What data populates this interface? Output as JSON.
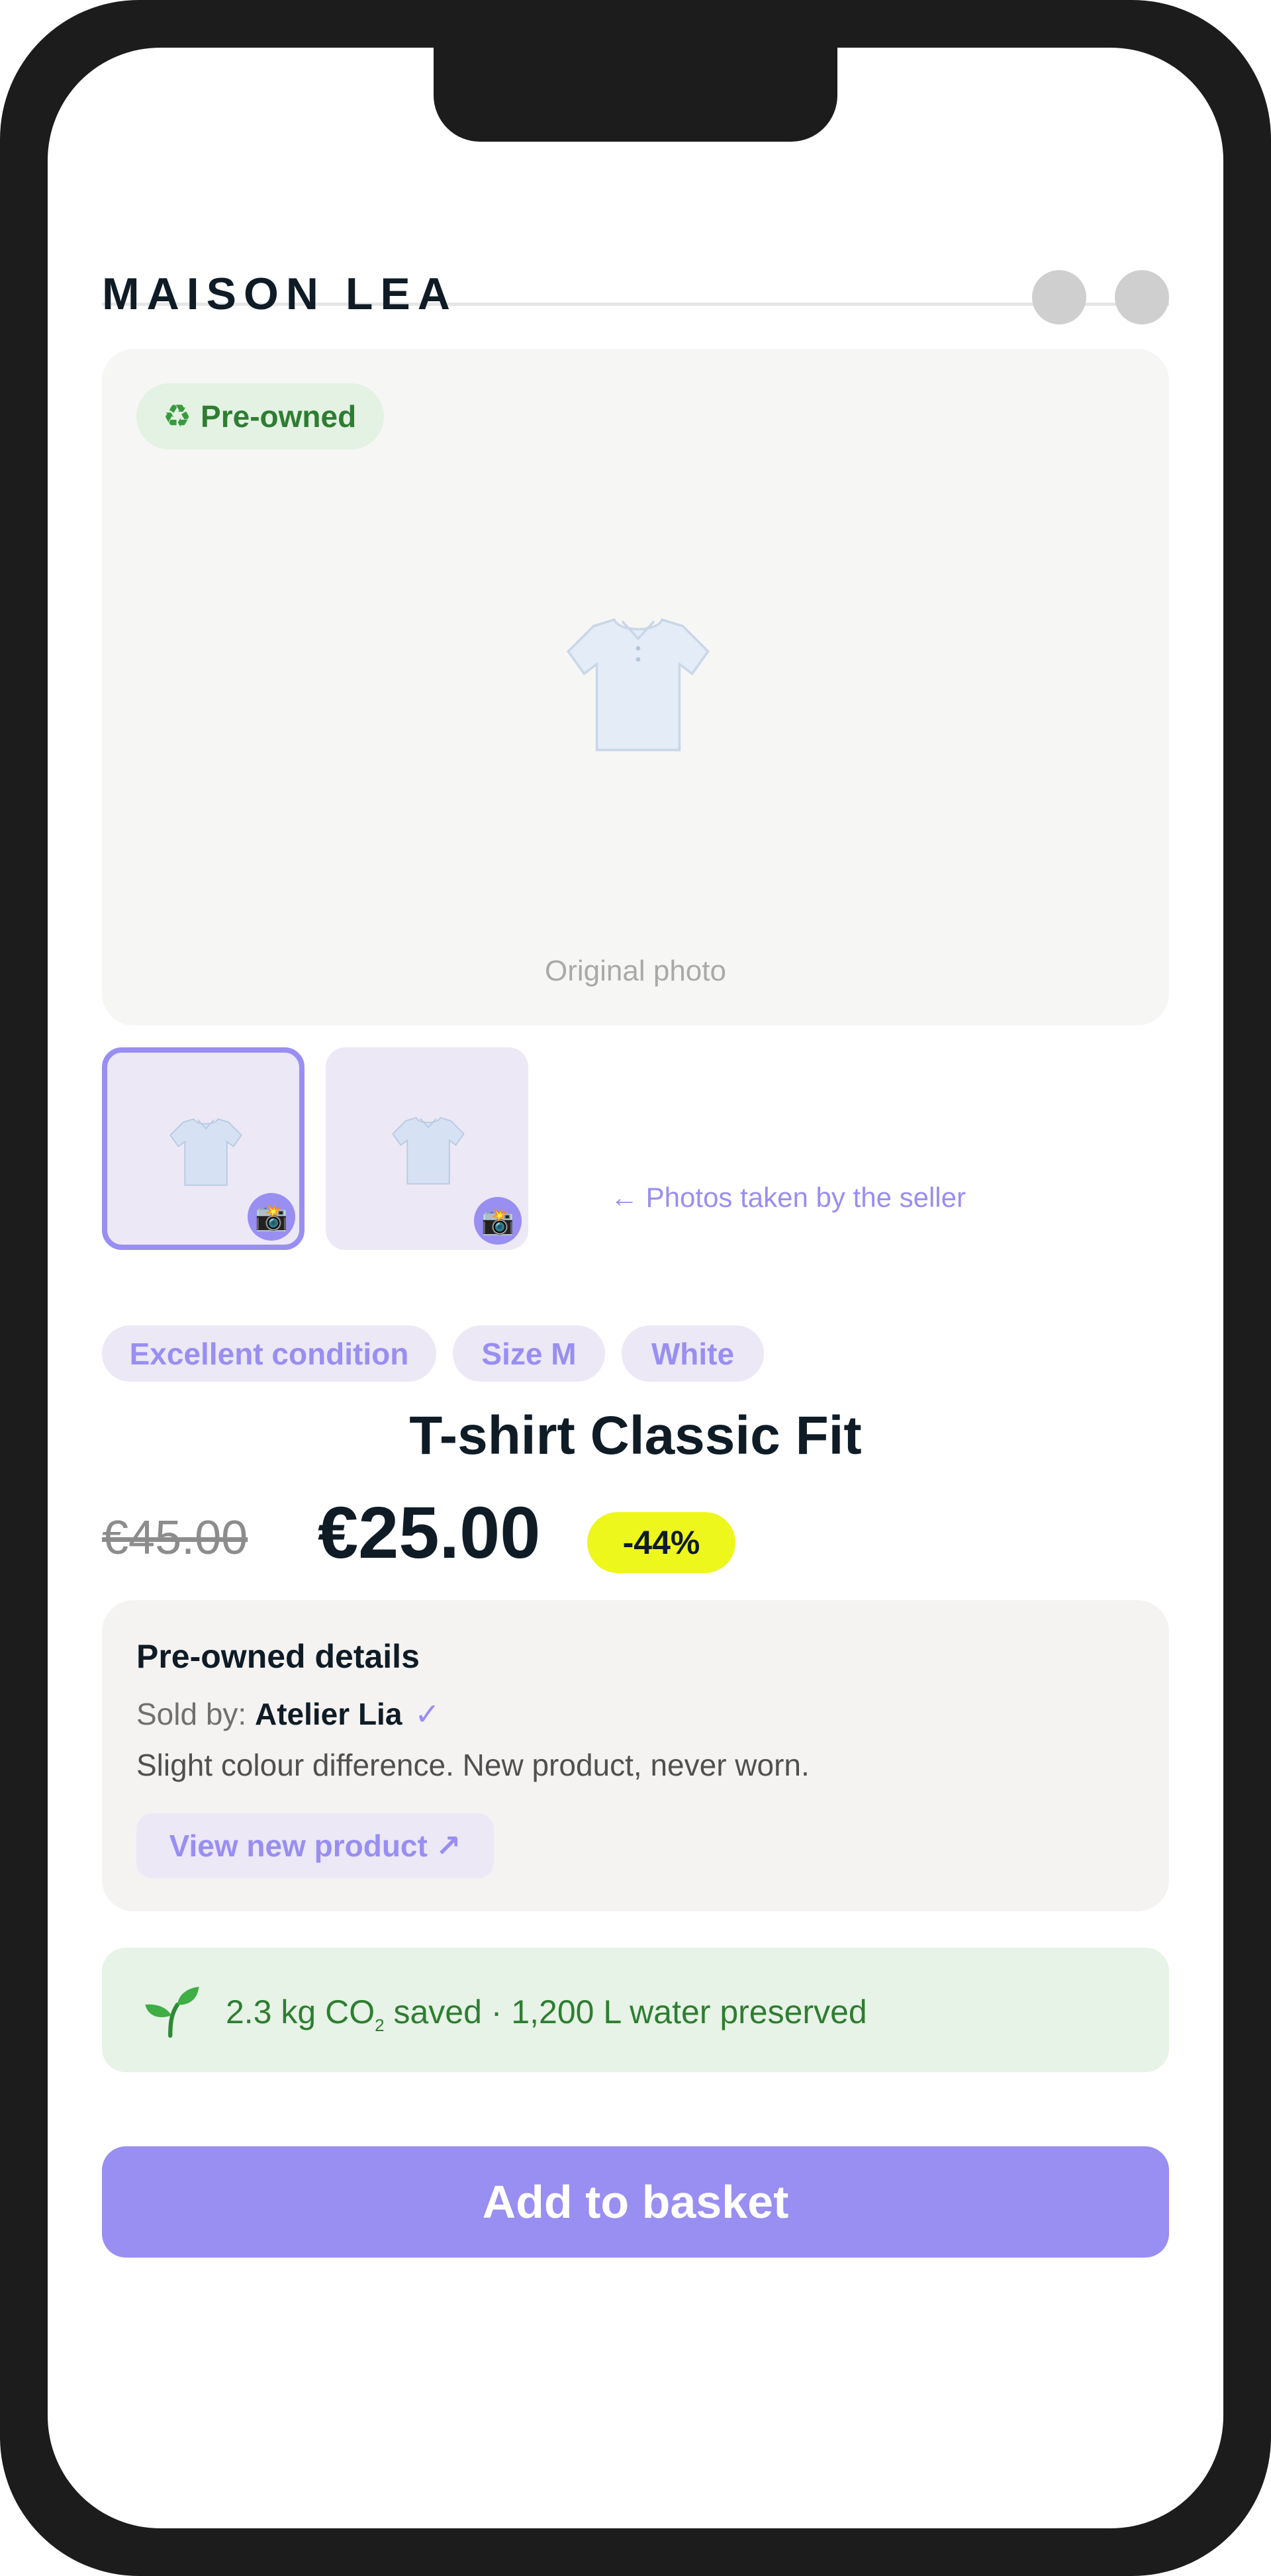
{
  "app": {
    "brand": "MAISON LEA"
  },
  "header": {
    "icons": [
      "circle-button",
      "circle-button"
    ]
  },
  "gallery": {
    "badge": {
      "icon": "recycle-icon",
      "label": "Pre-owned"
    },
    "main_caption": "Original photo",
    "thumbnails": [
      {
        "icon": "tshirt-icon",
        "overlay_icon": "camera-icon",
        "selected": true
      },
      {
        "icon": "tshirt-icon",
        "overlay_icon": "camera-icon",
        "selected": false
      }
    ],
    "seller_note": "← Photos taken by the seller"
  },
  "tags": [
    "Excellent condition",
    "Size M",
    "White"
  ],
  "product": {
    "title": "T-shirt Classic Fit",
    "price_old": "€45.00",
    "price_new": "€25.00",
    "discount": "-44%"
  },
  "details": {
    "title": "Pre-owned details",
    "sold_by_label": "Sold by:",
    "seller": "Atelier Lia",
    "verified_mark": "✓",
    "description": "Slight colour difference. New product, never worn.",
    "view_new_label": "View new product",
    "view_new_icon": "↗"
  },
  "eco": {
    "icon": "sprout-icon",
    "co2_value": "2.3 kg CO",
    "co2_sub": "2",
    "rest": " saved · 1,200 L water preserved"
  },
  "cta": {
    "label": "Add to basket"
  },
  "colors": {
    "accent": "#998ef2",
    "accent_soft": "#ece8f5",
    "discount_bg": "#eef71b",
    "eco_bg": "#e6f3e6",
    "eco_text": "#2f7d32",
    "text_dark": "#0f1c26"
  }
}
